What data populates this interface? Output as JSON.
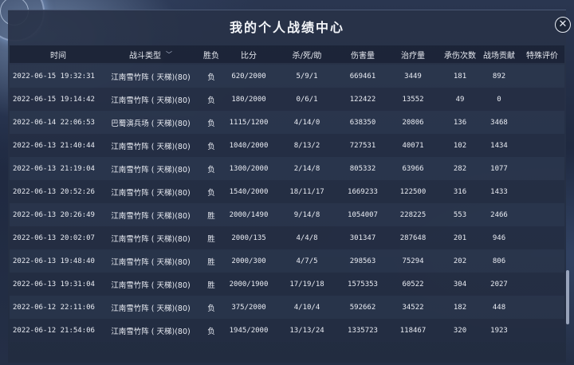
{
  "title": "我的个人战绩中心",
  "close_glyph": "✕",
  "columns": {
    "time": "时间",
    "type": "战斗类型",
    "result": "胜负",
    "score": "比分",
    "kda": "杀/死/助",
    "damage": "伤害量",
    "heal": "治疗量",
    "hits_taken": "承伤次数",
    "contribution": "战场贡献",
    "special": "特殊评价"
  },
  "filter_icon": "chevron-down-icon",
  "rows": [
    {
      "time": "2022-06-15 19:32:31",
      "type": "江南雪竹阵 ( 天梯)(80)",
      "result": "负",
      "score": "620/2000",
      "kda": "5/9/1",
      "damage": "669461",
      "heal": "3449",
      "hits": "181",
      "contrib": "892",
      "special": ""
    },
    {
      "time": "2022-06-15 19:14:42",
      "type": "江南雪竹阵 ( 天梯)(80)",
      "result": "负",
      "score": "180/2000",
      "kda": "0/6/1",
      "damage": "122422",
      "heal": "13552",
      "hits": "49",
      "contrib": "0",
      "special": ""
    },
    {
      "time": "2022-06-14 22:06:53",
      "type": "巴蜀演兵场 ( 天梯)(80)",
      "result": "负",
      "score": "1115/1200",
      "kda": "4/14/0",
      "damage": "638350",
      "heal": "20806",
      "hits": "136",
      "contrib": "3468",
      "special": ""
    },
    {
      "time": "2022-06-13 21:40:44",
      "type": "江南雪竹阵 ( 天梯)(80)",
      "result": "负",
      "score": "1040/2000",
      "kda": "8/13/2",
      "damage": "727531",
      "heal": "40071",
      "hits": "102",
      "contrib": "1434",
      "special": ""
    },
    {
      "time": "2022-06-13 21:19:04",
      "type": "江南雪竹阵 ( 天梯)(80)",
      "result": "负",
      "score": "1300/2000",
      "kda": "2/14/8",
      "damage": "805332",
      "heal": "63966",
      "hits": "282",
      "contrib": "1077",
      "special": ""
    },
    {
      "time": "2022-06-13 20:52:26",
      "type": "江南雪竹阵 ( 天梯)(80)",
      "result": "负",
      "score": "1540/2000",
      "kda": "18/11/17",
      "damage": "1669233",
      "heal": "122500",
      "hits": "316",
      "contrib": "1433",
      "special": ""
    },
    {
      "time": "2022-06-13 20:26:49",
      "type": "江南雪竹阵 ( 天梯)(80)",
      "result": "胜",
      "score": "2000/1490",
      "kda": "9/14/8",
      "damage": "1054007",
      "heal": "228225",
      "hits": "553",
      "contrib": "2466",
      "special": ""
    },
    {
      "time": "2022-06-13 20:02:07",
      "type": "江南雪竹阵 ( 天梯)(80)",
      "result": "胜",
      "score": "2000/135",
      "kda": "4/4/8",
      "damage": "301347",
      "heal": "287648",
      "hits": "201",
      "contrib": "946",
      "special": ""
    },
    {
      "time": "2022-06-13 19:48:40",
      "type": "江南雪竹阵 ( 天梯)(80)",
      "result": "胜",
      "score": "2000/300",
      "kda": "4/7/5",
      "damage": "298563",
      "heal": "75294",
      "hits": "202",
      "contrib": "806",
      "special": ""
    },
    {
      "time": "2022-06-13 19:31:04",
      "type": "江南雪竹阵 ( 天梯)(80)",
      "result": "胜",
      "score": "2000/1900",
      "kda": "17/19/18",
      "damage": "1575353",
      "heal": "60522",
      "hits": "304",
      "contrib": "2027",
      "special": ""
    },
    {
      "time": "2022-06-12 22:11:06",
      "type": "江南雪竹阵 ( 天梯)(80)",
      "result": "负",
      "score": "375/2000",
      "kda": "4/10/4",
      "damage": "592662",
      "heal": "34522",
      "hits": "182",
      "contrib": "448",
      "special": ""
    },
    {
      "time": "2022-06-12 21:54:06",
      "type": "江南雪竹阵 ( 天梯)(80)",
      "result": "负",
      "score": "1945/2000",
      "kda": "13/13/24",
      "damage": "1335723",
      "heal": "118467",
      "hits": "320",
      "contrib": "1923",
      "special": ""
    }
  ]
}
